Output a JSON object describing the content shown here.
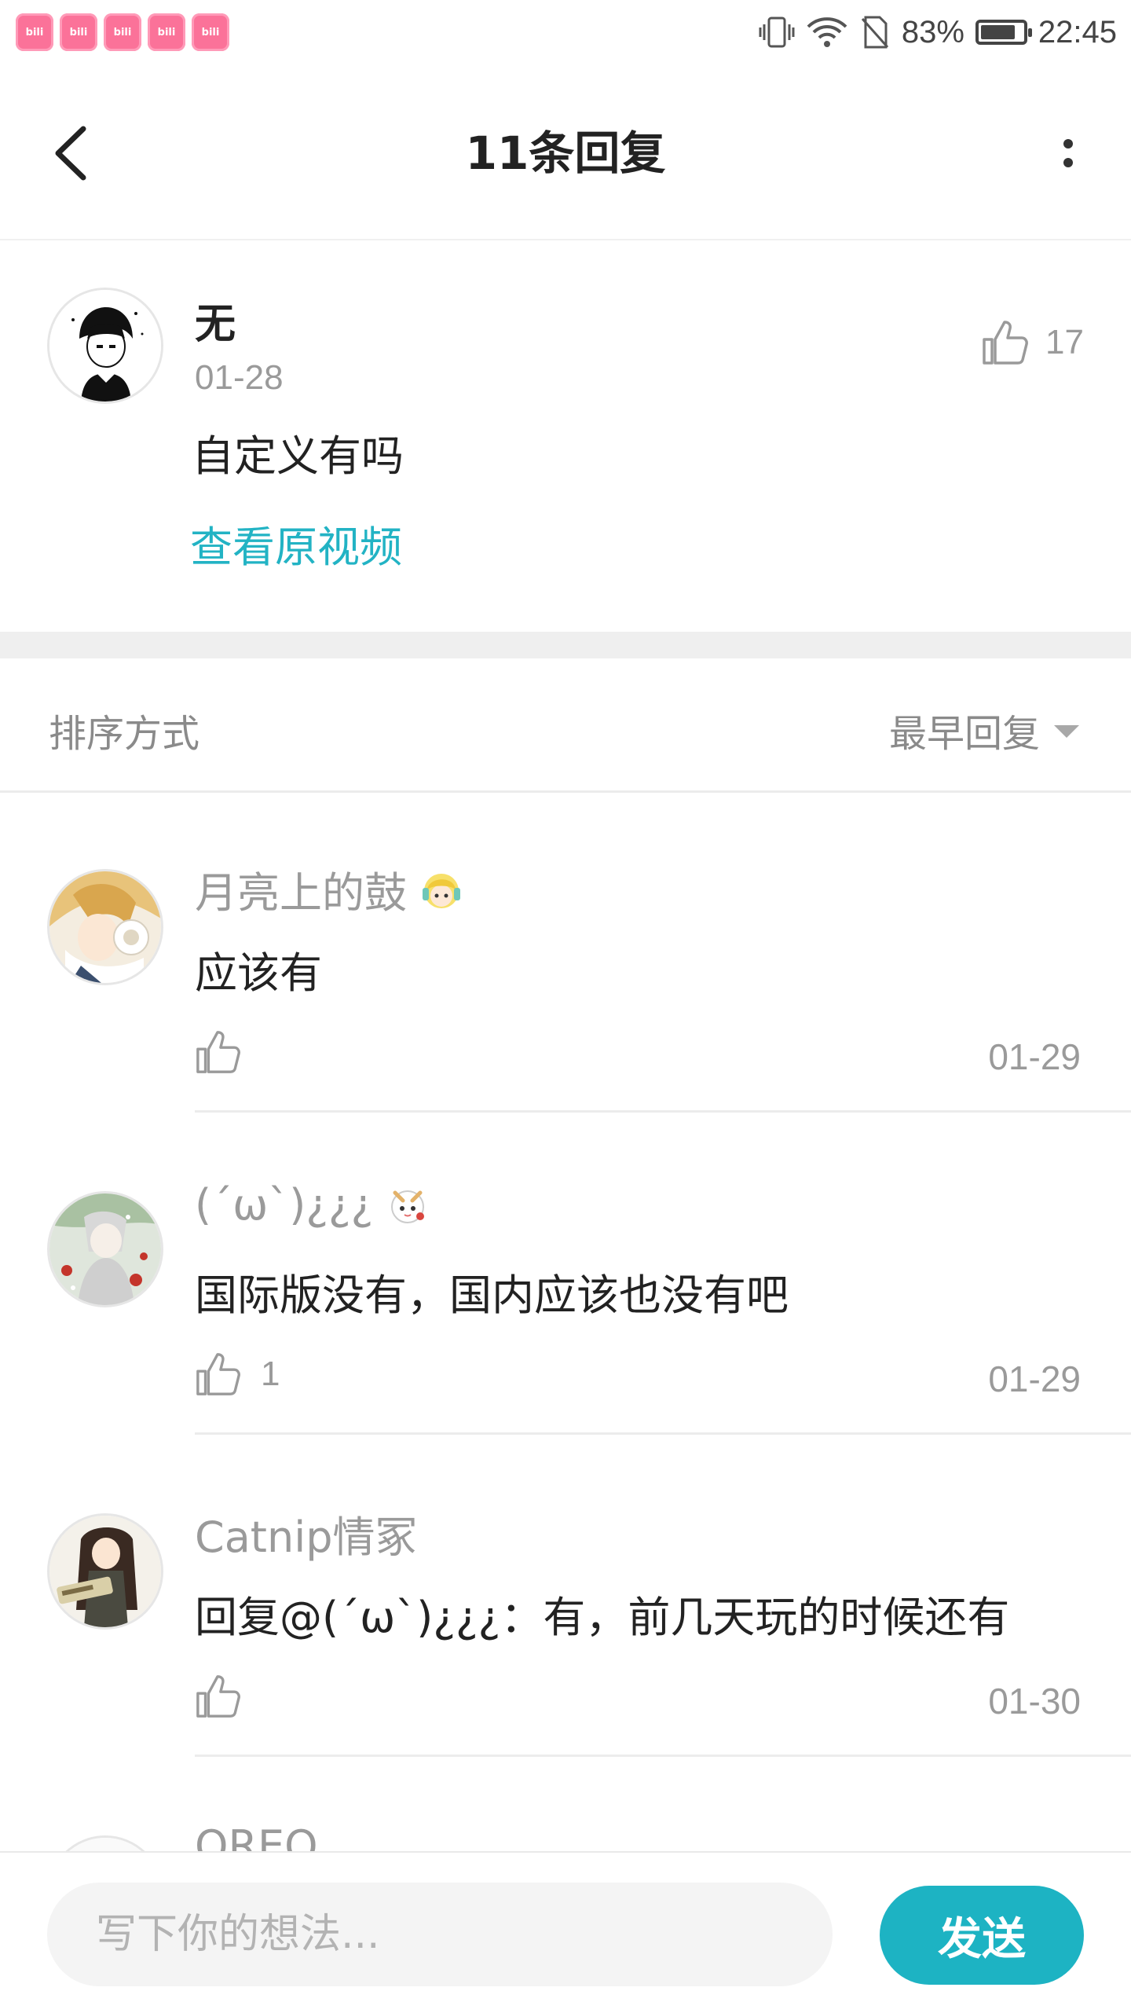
{
  "status_bar": {
    "app_icons": [
      "bilibili",
      "bilibili",
      "bilibili",
      "bilibili",
      "bilibili"
    ],
    "icons": [
      "vibrate-icon",
      "wifi-icon",
      "no-sim-icon",
      "battery-icon"
    ],
    "battery": "83%",
    "battery_level": 0.83,
    "time": "22:45"
  },
  "header": {
    "title": "11条回复",
    "back_icon": "chevron-left-icon",
    "more_icon": "more-vertical-icon"
  },
  "root_comment": {
    "username": "无",
    "date": "01-28",
    "likes": "17",
    "text": "自定义有吗",
    "link": "查看原视频"
  },
  "sort": {
    "label": "排序方式",
    "value": "最早回复"
  },
  "replies": [
    {
      "username": "月亮上的鼓",
      "text": "应该有",
      "likes": "",
      "date": "01-29",
      "badge": "yellow-hair-badge-icon"
    },
    {
      "username": "(ˊωˋ)¿¿¿",
      "text": "国际版没有，国内应该也没有吧",
      "likes": "1",
      "date": "01-29",
      "badge": "white-creature-badge-icon"
    },
    {
      "username": "Catnip情冢",
      "text": "回复@(ˊωˋ)¿¿¿：有，前几天玩的时候还有",
      "likes": "",
      "date": "01-30",
      "badge": ""
    },
    {
      "username": "OREO",
      "text": "",
      "likes": "",
      "date": "",
      "badge": ""
    }
  ],
  "composer": {
    "placeholder": "写下你的想法...",
    "send_label": "发送"
  },
  "colors": {
    "accent": "#1db3c3",
    "link": "#22b3c4",
    "bilibili_pink": "#fb7299"
  }
}
